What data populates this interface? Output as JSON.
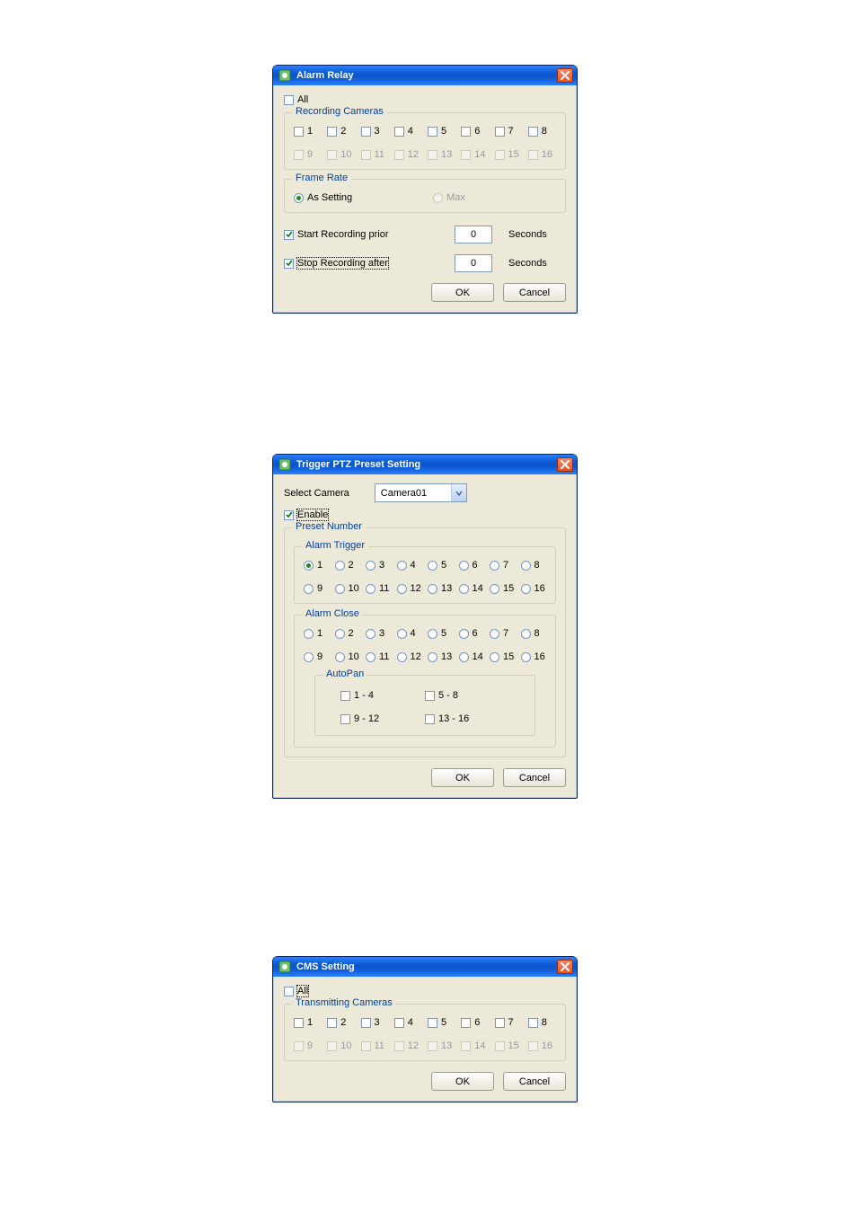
{
  "dlg1": {
    "title": "Alarm Relay",
    "all_label": "All",
    "recording_cameras_label": "Recording Cameras",
    "cams": [
      "1",
      "2",
      "3",
      "4",
      "5",
      "6",
      "7",
      "8",
      "9",
      "10",
      "11",
      "12",
      "13",
      "14",
      "15",
      "16"
    ],
    "frame_rate_label": "Frame Rate",
    "as_setting_label": "As Setting",
    "max_label": "Max",
    "start_label": "Start Recording prior",
    "stop_label": "Stop Recording after",
    "start_val": "0",
    "stop_val": "0",
    "seconds_label": "Seconds",
    "ok": "OK",
    "cancel": "Cancel"
  },
  "dlg2": {
    "title": "Trigger PTZ Preset Setting",
    "select_camera_label": "Select Camera",
    "selected_camera": "Camera01",
    "enable_label": "Enable",
    "preset_number_label": "Preset Number",
    "alarm_trigger_label": "Alarm Trigger",
    "alarm_close_label": "Alarm Close",
    "presets": [
      "1",
      "2",
      "3",
      "4",
      "5",
      "6",
      "7",
      "8",
      "9",
      "10",
      "11",
      "12",
      "13",
      "14",
      "15",
      "16"
    ],
    "autopan_label": "AutoPan",
    "ap": [
      "1 - 4",
      "5 - 8",
      "9 - 12",
      "13 - 16"
    ],
    "ok": "OK",
    "cancel": "Cancel"
  },
  "dlg3": {
    "title": "CMS Setting",
    "all_label": "All",
    "transmitting_cameras_label": "Transmitting Cameras",
    "cams": [
      "1",
      "2",
      "3",
      "4",
      "5",
      "6",
      "7",
      "8",
      "9",
      "10",
      "11",
      "12",
      "13",
      "14",
      "15",
      "16"
    ],
    "ok": "OK",
    "cancel": "Cancel"
  }
}
